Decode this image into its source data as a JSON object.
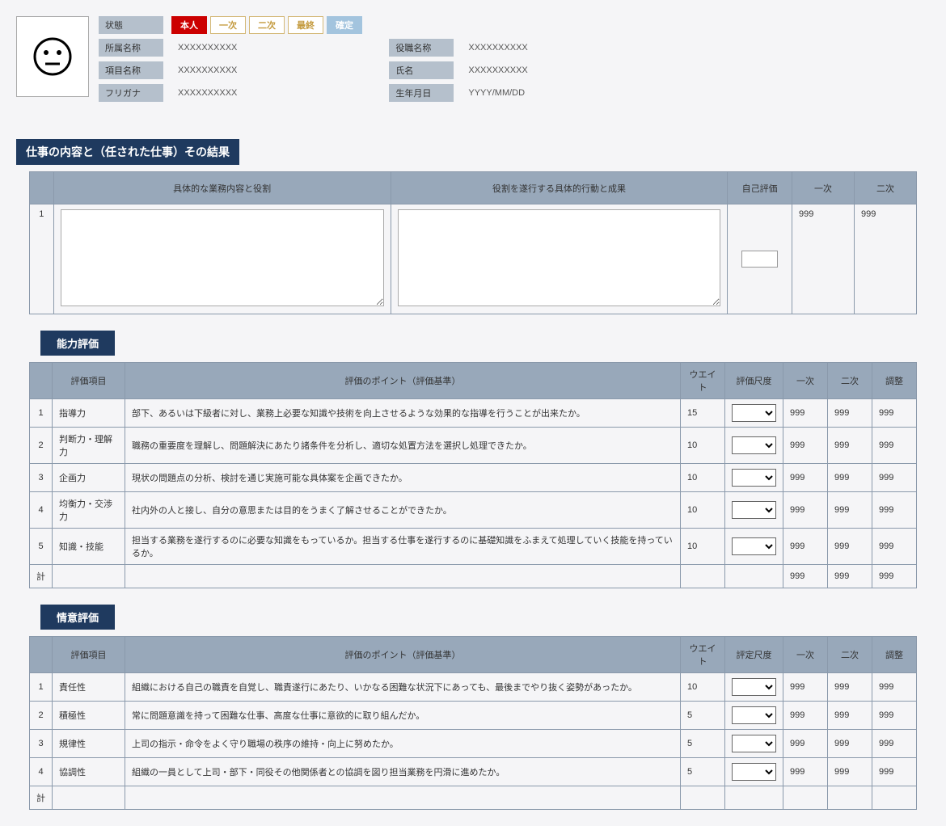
{
  "profile": {
    "status_label": "状態",
    "badges": {
      "self": "本人",
      "first": "一次",
      "second": "二次",
      "final": "最終",
      "confirmed": "確定"
    },
    "left_fields": [
      {
        "label": "所属名称",
        "value": "XXXXXXXXXX"
      },
      {
        "label": "項目名称",
        "value": "XXXXXXXXXX"
      },
      {
        "label": "フリガナ",
        "value": "XXXXXXXXXX"
      }
    ],
    "right_fields": [
      {
        "label": "役職名称",
        "value": "XXXXXXXXXX"
      },
      {
        "label": "氏名",
        "value": "XXXXXXXXXX"
      },
      {
        "label": "生年月日",
        "value": "YYYY/MM/DD"
      }
    ]
  },
  "section1": {
    "title": "仕事の内容と（任された仕事）その結果",
    "headers": {
      "content": "具体的な業務内容と役割",
      "action": "役割を遂行する具体的行動と成果",
      "self": "自己評価",
      "first": "一次",
      "second": "二次"
    },
    "row": {
      "num": "1",
      "first_val": "999",
      "second_val": "999"
    }
  },
  "section2": {
    "title": "能力評価",
    "headers": {
      "item": "評価項目",
      "point": "評価のポイント（評価基準）",
      "weight": "ウエイト",
      "scale": "評価尺度",
      "first": "一次",
      "second": "二次",
      "adjust": "調整"
    },
    "rows": [
      {
        "num": "1",
        "item": "指導力",
        "desc": "部下、あるいは下級者に対し、業務上必要な知識や技術を向上させるような効果的な指導を行うことが出来たか。",
        "weight": "15",
        "first": "999",
        "second": "999",
        "adjust": "999"
      },
      {
        "num": "2",
        "item": "判断力・理解力",
        "desc": "職務の重要度を理解し、問題解決にあたり諸条件を分析し、適切な処置方法を選択し処理できたか。",
        "weight": "10",
        "first": "999",
        "second": "999",
        "adjust": "999"
      },
      {
        "num": "3",
        "item": "企画力",
        "desc": "現状の問題点の分析、検討を通じ実施可能な具体案を企画できたか。",
        "weight": "10",
        "first": "999",
        "second": "999",
        "adjust": "999"
      },
      {
        "num": "4",
        "item": "均衡力・交渉力",
        "desc": "社内外の人と接し、自分の意思または目的をうまく了解させることができたか。",
        "weight": "10",
        "first": "999",
        "second": "999",
        "adjust": "999"
      },
      {
        "num": "5",
        "item": "知識・技能",
        "desc": "担当する業務を遂行するのに必要な知識をもっているか。担当する仕事を遂行するのに基礎知識をふまえて処理していく技能を持っているか。",
        "weight": "10",
        "first": "999",
        "second": "999",
        "adjust": "999"
      }
    ],
    "total": {
      "label": "計",
      "first": "999",
      "second": "999",
      "adjust": "999"
    }
  },
  "section3": {
    "title": "情意評価",
    "headers": {
      "item": "評価項目",
      "point": "評価のポイント（評価基準）",
      "weight": "ウエイト",
      "scale": "評定尺度",
      "first": "一次",
      "second": "二次",
      "adjust": "調整"
    },
    "rows": [
      {
        "num": "1",
        "item": "責任性",
        "desc": "組織における自己の職責を自覚し、職責遂行にあたり、いかなる困難な状況下にあっても、最後までやり抜く姿勢があったか。",
        "weight": "10",
        "first": "999",
        "second": "999",
        "adjust": "999"
      },
      {
        "num": "2",
        "item": "積極性",
        "desc": "常に問題意識を持って困難な仕事、高度な仕事に意欲的に取り組んだか。",
        "weight": "5",
        "first": "999",
        "second": "999",
        "adjust": "999"
      },
      {
        "num": "3",
        "item": "規律性",
        "desc": "上司の指示・命令をよく守り職場の秩序の維持・向上に努めたか。",
        "weight": "5",
        "first": "999",
        "second": "999",
        "adjust": "999"
      },
      {
        "num": "4",
        "item": "協調性",
        "desc": "組織の一員として上司・部下・同役その他関係者との協調を図り担当業務を円滑に進めたか。",
        "weight": "5",
        "first": "999",
        "second": "999",
        "adjust": "999"
      }
    ],
    "total": {
      "label": "計"
    }
  }
}
